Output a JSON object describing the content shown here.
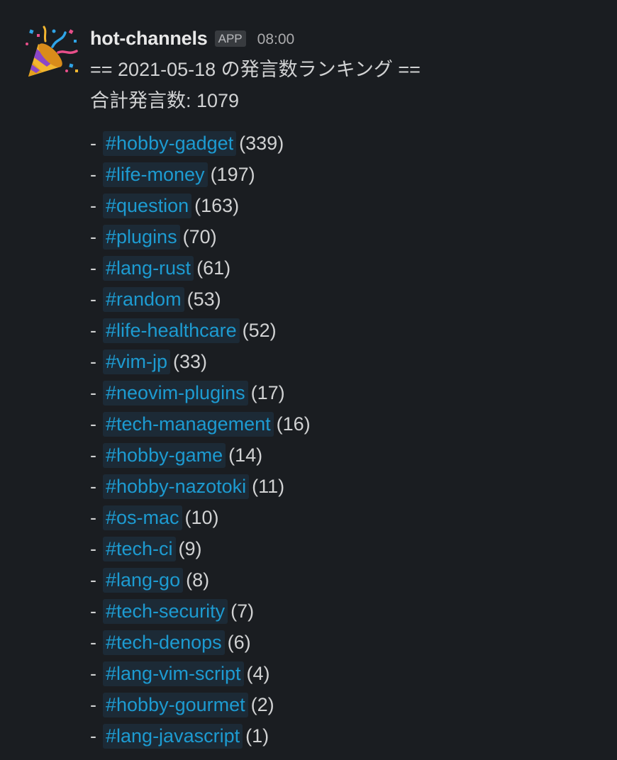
{
  "message": {
    "avatar_icon": "party-popper-icon",
    "username": "hot-channels",
    "badge": "APP",
    "time": "08:00",
    "title": "== 2021-05-18 の発言数ランキング ==",
    "total": "合計発言数: 1079",
    "items": [
      {
        "dash": "-",
        "channel": "#hobby-gadget",
        "count": "(339)"
      },
      {
        "dash": "-",
        "channel": "#life-money",
        "count": "(197)"
      },
      {
        "dash": "-",
        "channel": "#question",
        "count": "(163)"
      },
      {
        "dash": "-",
        "channel": "#plugins",
        "count": "(70)"
      },
      {
        "dash": "-",
        "channel": "#lang-rust",
        "count": "(61)"
      },
      {
        "dash": "-",
        "channel": "#random",
        "count": "(53)"
      },
      {
        "dash": "-",
        "channel": "#life-healthcare",
        "count": "(52)"
      },
      {
        "dash": "-",
        "channel": "#vim-jp",
        "count": "(33)"
      },
      {
        "dash": "-",
        "channel": "#neovim-plugins",
        "count": "(17)"
      },
      {
        "dash": "-",
        "channel": "#tech-management",
        "count": "(16)"
      },
      {
        "dash": "-",
        "channel": "#hobby-game",
        "count": "(14)"
      },
      {
        "dash": "-",
        "channel": "#hobby-nazotoki",
        "count": "(11)"
      },
      {
        "dash": "-",
        "channel": "#os-mac",
        "count": "(10)"
      },
      {
        "dash": "-",
        "channel": "#tech-ci",
        "count": "(9)"
      },
      {
        "dash": "-",
        "channel": "#lang-go",
        "count": "(8)"
      },
      {
        "dash": "-",
        "channel": "#tech-security",
        "count": "(7)"
      },
      {
        "dash": "-",
        "channel": "#tech-denops",
        "count": "(6)"
      },
      {
        "dash": "-",
        "channel": "#lang-vim-script",
        "count": "(4)"
      },
      {
        "dash": "-",
        "channel": "#hobby-gourmet",
        "count": "(2)"
      },
      {
        "dash": "-",
        "channel": "#lang-javascript",
        "count": "(1)"
      }
    ]
  },
  "colors": {
    "background": "#1a1d21",
    "text": "#d1d2d3",
    "channel_link": "#1d9bd1",
    "channel_bg": "#1c2a36"
  }
}
